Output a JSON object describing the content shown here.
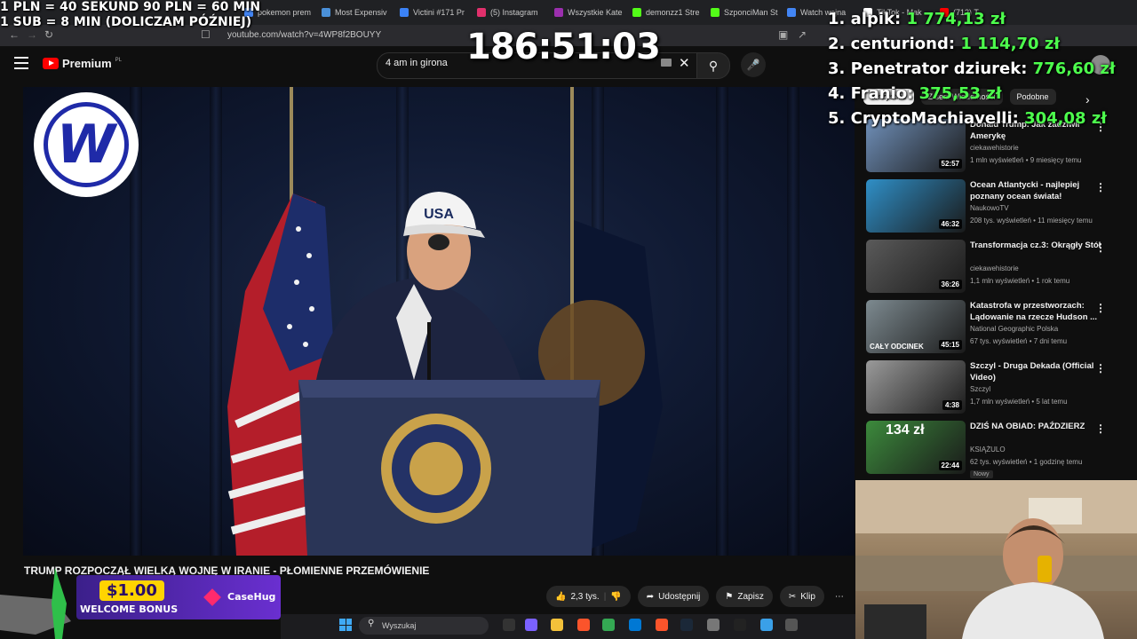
{
  "browser": {
    "tabs": [
      {
        "label": "pokemon prem",
        "color": "#4285f4"
      },
      {
        "label": "Most Expensiv",
        "color": "#4a90d9"
      },
      {
        "label": "Victini #171 Pr",
        "color": "#3b82f6"
      },
      {
        "label": "(5) Instagram",
        "color": "#e1306c"
      },
      {
        "label": "Wszystkie Kate",
        "color": "#9b2fae"
      },
      {
        "label": "demonzz1 Stre",
        "color": "#53fc18"
      },
      {
        "label": "SzponciMan St",
        "color": "#53fc18"
      },
      {
        "label": "Watch wojna",
        "color": "#4285f4"
      },
      {
        "label": "TikTok - Mak",
        "color": "#ffffff"
      },
      {
        "label": "(712) T",
        "color": "#ff0000"
      }
    ],
    "url": "youtube.com/watch?v=4WP8f2BOUYY"
  },
  "youtube": {
    "logo_label": "Premium",
    "logo_region": "PL",
    "search_value": "4 am in girona"
  },
  "overlay": {
    "rule_line1": "1 PLN = 40 SEKUND 90 PLN = 60 MIN",
    "rule_line2": "1 SUB = 8 MIN (DOLICZAM PÓŹNIEJ)",
    "timer": "186:51:03",
    "leaderboard": [
      {
        "name": "1. alpik: ",
        "amount": "1 774,13 zł"
      },
      {
        "name": "2. centuriond: ",
        "amount": "1 114,70 zł"
      },
      {
        "name": "3. Penetrator dziurek: ",
        "amount": "776,60 zł"
      },
      {
        "name": "4. Franio: ",
        "amount": "375,53 zł"
      },
      {
        "name": "5. CryptoMachiavelli: ",
        "amount": "304,08 zł"
      }
    ]
  },
  "sidebar": {
    "chips": [
      "Wszystkie",
      "Z serii Wiadomości",
      "Podobne"
    ],
    "recommendations": [
      {
        "title": "Donald Trump. Jak zadziwił Amerykę",
        "channel": "ciekawehistorie",
        "meta": "1 mln wyświetleń • 9 miesięcy temu",
        "duration": "52:57",
        "color": "#6f8fb8"
      },
      {
        "title": "Ocean Atlantycki - najlepiej poznany ocean świata!",
        "channel": "NaukowoTV",
        "meta": "208 tys. wyświetleń • 11 miesięcy temu",
        "duration": "46:32",
        "color": "#2f8fc7"
      },
      {
        "title": "Transformacja cz.3: Okrągły Stół",
        "channel": "ciekawehistorie",
        "meta": "1,1 mln wyświetleń • 1 rok temu",
        "duration": "36:26",
        "color": "#5a5a5a"
      },
      {
        "title": "Katastrofa w przestworzach: Lądowanie na rzecze Hudson ...",
        "channel": "National Geographic Polska",
        "meta": "67 tys. wyświetleń • 7 dni temu",
        "duration": "45:15",
        "color": "#7d8a90"
      },
      {
        "title": "Szczyl - Druga Dekada (Official Video)",
        "channel": "Szczyl",
        "meta": "1,7 mln wyświetleń • 5 lat temu",
        "duration": "4:38",
        "color": "#9a9a9a"
      },
      {
        "title": "DZIŚ NA OBIAD: PAŹDZIERZ",
        "channel": "KSIĄŻULO",
        "meta": "62 tys. wyświetleń • 1 godzinę temu",
        "duration": "22:44",
        "color": "#3c8a3c"
      }
    ],
    "new_badge": "Nowy",
    "thumb4_label": "CAŁY ODCINEK",
    "thumb6_label": "134 zł"
  },
  "video": {
    "title": "TRUMP ROZPOCZĄŁ WIELKĄ WOJNĘ W IRANIE - PŁOMIENNE PRZEMÓWIENIE",
    "channel_logo": "W",
    "cap_text": "USA",
    "likes": "2,3 tys.",
    "share": "Udostępnij",
    "save": "Zapisz",
    "clip": "Klip"
  },
  "promo": {
    "amount": "$1.00",
    "bonus": "WELCOME BONUS",
    "brand": "CaseHug"
  },
  "taskbar": {
    "search_placeholder": "Wyszukaj"
  }
}
